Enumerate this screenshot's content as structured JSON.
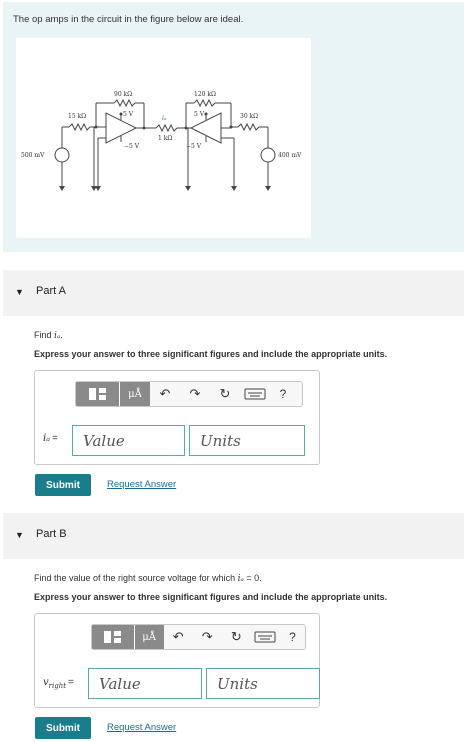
{
  "problem": {
    "text": "The op amps in the circuit in the figure below are ideal.",
    "figure_labels": {
      "r1": "15 kΩ",
      "r2": "90 kΩ",
      "r3": "1 kΩ",
      "r4": "120 kΩ",
      "r5": "30 kΩ",
      "v_left": "500 mV",
      "v_right": "400 mV",
      "vpos1": "5 V",
      "vneg1": "−5 V",
      "vpos2": "5 V",
      "vneg2": "−5 V",
      "ia": "iₐ"
    }
  },
  "part_a": {
    "title": "Part A",
    "find_prefix": "Find",
    "find_var": "iₐ",
    "find_suffix": ".",
    "instruction": "Express your answer to three significant figures and include the appropriate units.",
    "toolbar": {
      "mu": "μÅ",
      "help": "?"
    },
    "var_label": "iₐ",
    "value_placeholder": "Value",
    "units_placeholder": "Units",
    "submit": "Submit",
    "request": "Request Answer"
  },
  "part_b": {
    "title": "Part B",
    "find_text": "Find the value of the right source voltage for which",
    "find_var": "iₐ",
    "find_eq": " = 0.",
    "instruction": "Express your answer to three significant figures and include the appropriate units.",
    "toolbar": {
      "mu": "μÅ",
      "help": "?"
    },
    "var_label": "v",
    "var_sub": "right",
    "value_placeholder": "Value",
    "units_placeholder": "Units",
    "submit": "Submit",
    "request": "Request Answer"
  }
}
